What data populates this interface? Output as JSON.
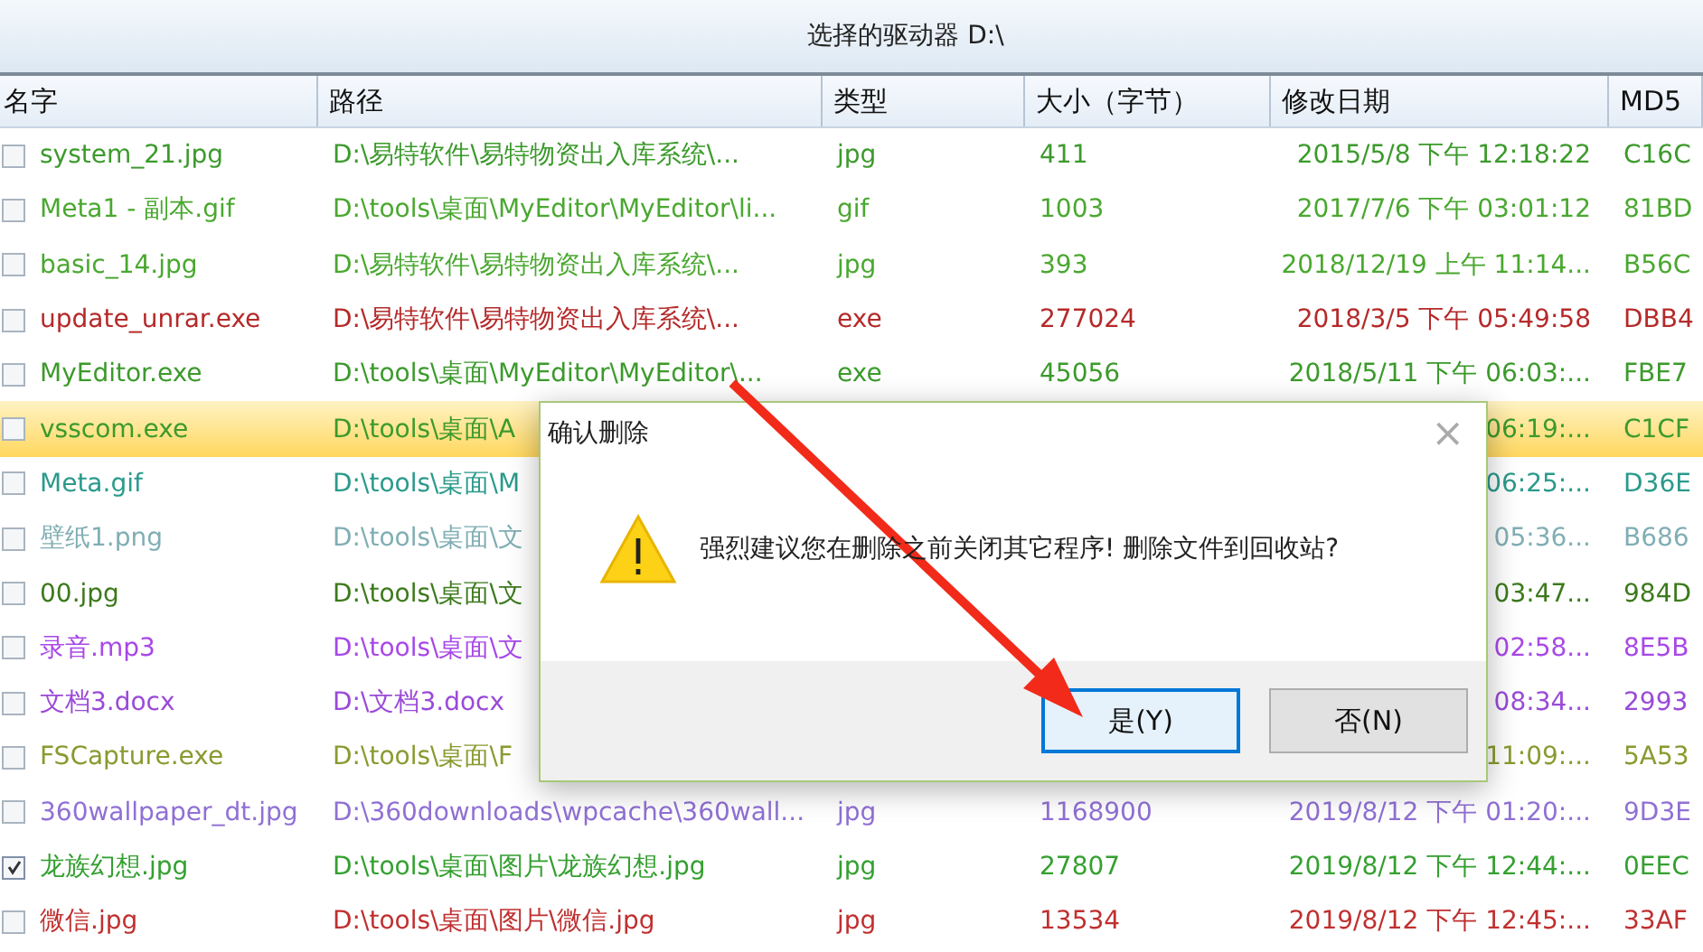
{
  "window": {
    "title": "选择的驱动器 D:\\"
  },
  "table": {
    "columns": [
      "名字",
      "路径",
      "类型",
      "大小（字节）",
      "修改日期",
      "MD5"
    ],
    "rows": [
      {
        "name": "system_21.jpg",
        "path": "D:\\易特软件\\易特物资出入库系统\\...",
        "type": "jpg",
        "size": "411",
        "date": "2015/5/8 下午 12:18:22",
        "md5": "C16C",
        "color": "#3c9a2c",
        "checked": false,
        "selected": false
      },
      {
        "name": "Meta1 - 副本.gif",
        "path": "D:\\tools\\桌面\\MyEditor\\MyEditor\\li...",
        "type": "gif",
        "size": "1003",
        "date": "2017/7/6 下午 03:01:12",
        "md5": "81BD",
        "color": "#4aa830",
        "checked": false,
        "selected": false
      },
      {
        "name": "basic_14.jpg",
        "path": "D:\\易特软件\\易特物资出入库系统\\...",
        "type": "jpg",
        "size": "393",
        "date": "2018/12/19 上午 11:14...",
        "md5": "B56C",
        "color": "#4aa830",
        "checked": false,
        "selected": false
      },
      {
        "name": "update_unrar.exe",
        "path": "D:\\易特软件\\易特物资出入库系统\\...",
        "type": "exe",
        "size": "277024",
        "date": "2018/3/5 下午 05:49:58",
        "md5": "DBB4",
        "color": "#b52a2a",
        "checked": false,
        "selected": false
      },
      {
        "name": "MyEditor.exe",
        "path": "D:\\tools\\桌面\\MyEditor\\MyEditor\\...",
        "type": "exe",
        "size": "45056",
        "date": "2018/5/11 下午 06:03:...",
        "md5": "FBE7",
        "color": "#3c9a2c",
        "checked": false,
        "selected": false
      },
      {
        "name": "vsscom.exe",
        "path": "D:\\tools\\桌面\\A",
        "date": "06:19:...",
        "md5": "C1CF",
        "color": "#3c9a2c",
        "checked": false,
        "selected": true
      },
      {
        "name": "Meta.gif",
        "path": "D:\\tools\\桌面\\M",
        "date": "06:25:...",
        "md5": "D36E",
        "color": "#2a9a8c",
        "checked": false,
        "selected": false
      },
      {
        "name": "壁纸1.png",
        "path": "D:\\tools\\桌面\\文",
        "date": "05:36...",
        "md5": "B686",
        "color": "#80aeb4",
        "checked": false,
        "selected": false
      },
      {
        "name": "00.jpg",
        "path": "D:\\tools\\桌面\\文",
        "date": "03:47...",
        "md5": "984D",
        "color": "#3c7a1c",
        "checked": false,
        "selected": false
      },
      {
        "name": "录音.mp3",
        "path": "D:\\tools\\桌面\\文",
        "date": "02:58...",
        "md5": "8E5B",
        "color": "#a848e8",
        "checked": false,
        "selected": false
      },
      {
        "name": "文档3.docx",
        "path": "D:\\文档3.docx",
        "date": "08:34...",
        "md5": "2993",
        "color": "#9a4ad8",
        "checked": false,
        "selected": false
      },
      {
        "name": "FSCapture.exe",
        "path": "D:\\tools\\桌面\\F",
        "date": "11:09:...",
        "md5": "5A53",
        "color": "#8a9a30",
        "checked": false,
        "selected": false
      },
      {
        "name": "360wallpaper_dt.jpg",
        "path": "D:\\360downloads\\wpcache\\360wall...",
        "type": "jpg",
        "size": "1168900",
        "date": "2019/8/12 下午 01:20:...",
        "md5": "9D3E",
        "color": "#9070d4",
        "checked": false,
        "selected": false
      },
      {
        "name": "龙族幻想.jpg",
        "path": "D:\\tools\\桌面\\图片\\龙族幻想.jpg",
        "type": "jpg",
        "size": "27807",
        "date": "2019/8/12 下午 12:44:...",
        "md5": "0EEC",
        "color": "#34a030",
        "checked": true,
        "selected": false
      },
      {
        "name": "微信.jpg",
        "path": "D:\\tools\\桌面\\图片\\微信.jpg",
        "type": "jpg",
        "size": "13534",
        "date": "2019/8/12 下午 12:45:...",
        "md5": "33AF",
        "color": "#c03030",
        "checked": false,
        "selected": false
      }
    ]
  },
  "dialog": {
    "title": "确认删除",
    "close": "×",
    "message": "强烈建议您在删除之前关闭其它程序! 删除文件到回收站?",
    "buttons": [
      {
        "label": "是(Y)",
        "focused": true
      },
      {
        "label": "否(N)",
        "focused": false
      }
    ]
  }
}
